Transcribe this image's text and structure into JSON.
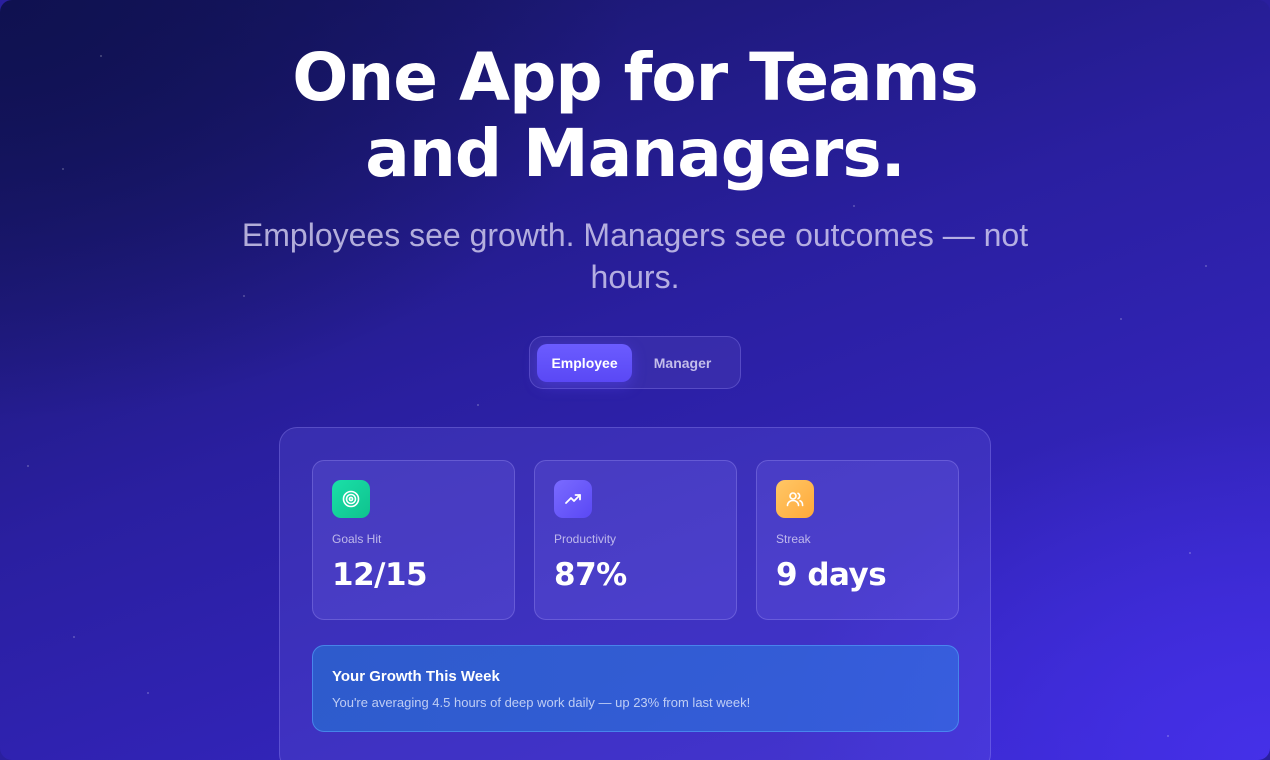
{
  "hero": {
    "title_line1": "One App for Teams",
    "title_line2": "and Managers.",
    "subtitle": "Employees see growth. Managers see outcomes — not hours."
  },
  "toggle": {
    "options": [
      {
        "label": "Employee",
        "active": true
      },
      {
        "label": "Manager",
        "active": false
      }
    ]
  },
  "stats": [
    {
      "label": "Goals Hit",
      "value": "12/15",
      "icon": "target-icon",
      "color": "#12d6a0"
    },
    {
      "label": "Productivity",
      "value": "87%",
      "icon": "trending-up-icon",
      "color": "#6b5cff"
    },
    {
      "label": "Streak",
      "value": "9 days",
      "icon": "users-icon",
      "color": "#ffb84d"
    }
  ],
  "growth": {
    "title": "Your Growth This Week",
    "text": "You're averaging 4.5 hours of deep work daily — up 23% from last week!"
  },
  "colors": {
    "accent": "#5a48f5",
    "background_start": "#15155f",
    "background_end": "#3a29d2"
  }
}
